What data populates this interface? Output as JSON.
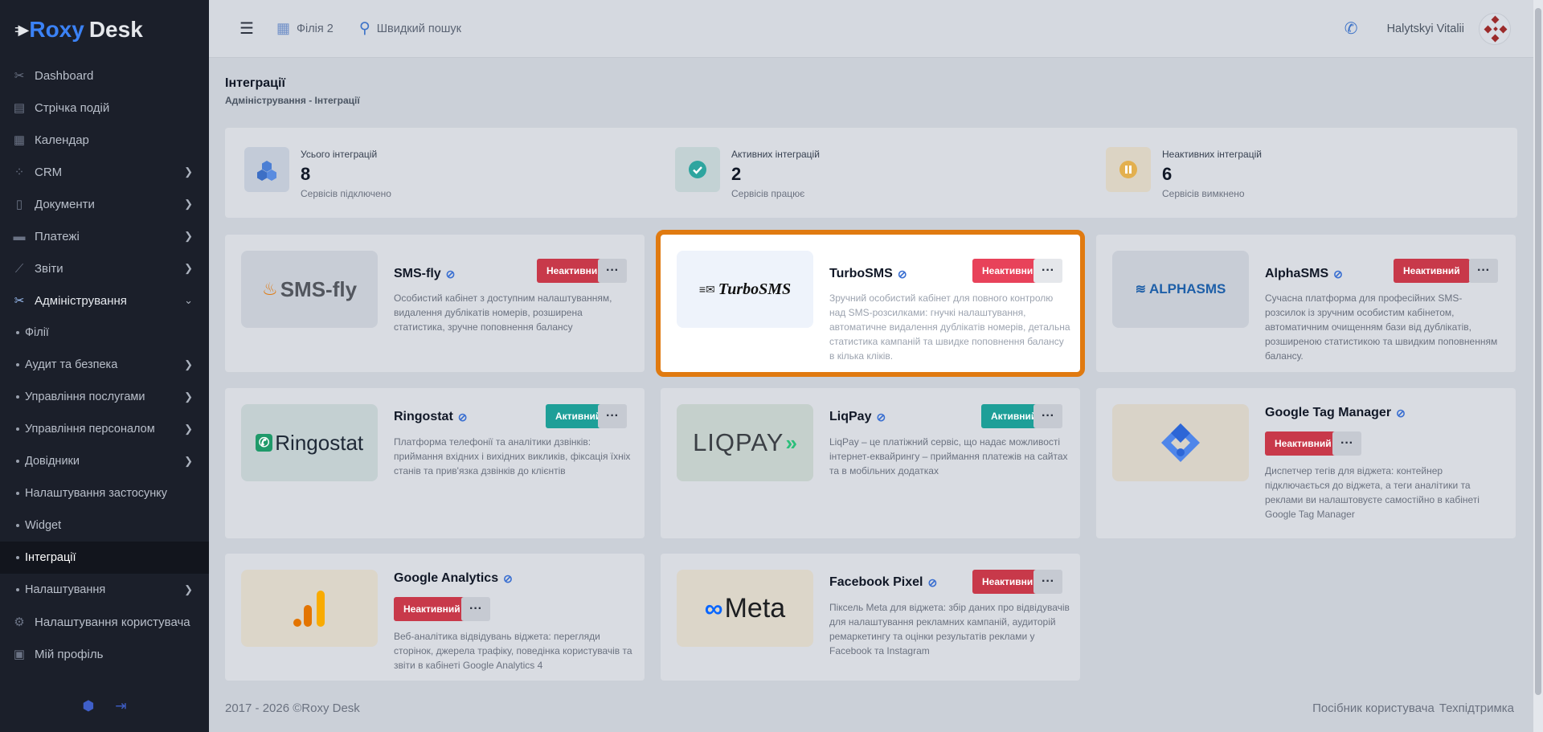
{
  "app": {
    "brand_part1": "Roxy",
    "brand_part2": "Desk"
  },
  "sidebar": {
    "items": [
      {
        "label": "Dashboard",
        "icon": "tools-icon"
      },
      {
        "label": "Стрічка подій",
        "icon": "feed-icon"
      },
      {
        "label": "Календар",
        "icon": "calendar-icon"
      },
      {
        "label": "CRM",
        "icon": "crm-icon"
      },
      {
        "label": "Документи",
        "icon": "document-icon"
      },
      {
        "label": "Платежі",
        "icon": "payment-icon"
      },
      {
        "label": "Звіти",
        "icon": "chart-icon"
      },
      {
        "label": "Адміністрування",
        "icon": "admin-icon"
      },
      {
        "label": "Філії"
      },
      {
        "label": "Аудит та безпека"
      },
      {
        "label": "Управління послугами"
      },
      {
        "label": "Управління персоналом"
      },
      {
        "label": "Довідники"
      },
      {
        "label": "Налаштування застосунку"
      },
      {
        "label": "Widget"
      },
      {
        "label": "Інтеграції"
      },
      {
        "label": "Налаштування"
      },
      {
        "label": "Налаштування користувача",
        "icon": "user-settings-icon"
      },
      {
        "label": "Мій профіль",
        "icon": "profile-icon"
      }
    ]
  },
  "topbar": {
    "branch": "Філія 2",
    "search": "Швидкий пошук",
    "user": "Halytskyi Vitalii"
  },
  "page": {
    "title": "Інтеграції",
    "breadcrumb": "Адміністрування - Інтеграції"
  },
  "stats": [
    {
      "label": "Усього інтеграцій",
      "value": "8",
      "sub": "Сервісів підключено"
    },
    {
      "label": "Активних інтеграцій",
      "value": "2",
      "sub": "Сервісів працює"
    },
    {
      "label": "Неактивних інтеграцій",
      "value": "6",
      "sub": "Сервісів вимкнено"
    }
  ],
  "cards": [
    {
      "name": "SMS-fly",
      "status": "Неактивний",
      "logo": "SMS-fly",
      "desc": "Особистий кабінет з доступним налаштуванням, видалення дублікатів номерів, розширена статистика, зручне поповнення балансу"
    },
    {
      "name": "TurboSMS",
      "status": "Неактивний",
      "logo": "TurboSMS",
      "desc": "Зручний особистий кабінет для повного контролю над SMS-розсилками: гнучкі налаштування, автоматичне видалення дублікатів номерів, детальна статистика кампаній та швидке поповнення балансу в кілька кліків."
    },
    {
      "name": "AlphaSMS",
      "status": "Неактивний",
      "logo": "ALPHASMS",
      "desc": "Сучасна платформа для професійних SMS-розсилок із зручним особистим кабінетом, автоматичним очищенням бази від дублікатів, розширеною статистикою та швидким поповненням балансу."
    },
    {
      "name": "Ringostat",
      "status": "Активний",
      "logo": "Ringostat",
      "desc": "Платформа телефонії та аналітики дзвінків: приймання вхідних і вихідних викликів, фіксація їхніх станів та прив'язка дзвінків до клієнтів"
    },
    {
      "name": "LiqPay",
      "status": "Активний",
      "logo": "LIQPAY",
      "desc": "LiqPay – це платіжний сервіс, що надає можливості інтернет-еквайрингу – приймання платежів на сайтах та в мобільних додатках"
    },
    {
      "name": "Google Tag Manager",
      "status": "Неактивний",
      "logo": "",
      "desc": "Диспетчер тегів для віджета: контейнер підключається до віджета, а теги аналітики та реклами ви налаштовуєте самостійно в кабінеті Google Tag Manager"
    },
    {
      "name": "Google Analytics",
      "status": "Неактивний",
      "logo": "",
      "desc": "Веб-аналітика відвідувань віджета: перегляди сторінок, джерела трафіку, поведінка користувачів та звіти в кабінеті Google Analytics 4"
    },
    {
      "name": "Facebook Pixel",
      "status": "Неактивний",
      "logo": "Meta",
      "desc": "Піксель Meta для віджета: збір даних про відвідувачів для налаштування рекламних кампаній, аудиторій ремаркетингу та оцінки результатів реклами у Facebook та Instagram"
    }
  ],
  "more_label": "···",
  "footer": {
    "copyright": "2017 - 2026 ©Roxy Desk",
    "guide": "Посібник користувача",
    "support": "Техпідтримка"
  },
  "colors": {
    "accent": "#3b82f6",
    "inactive": "#c8394a",
    "active": "#1e9f98",
    "selection": "#e07a10"
  }
}
